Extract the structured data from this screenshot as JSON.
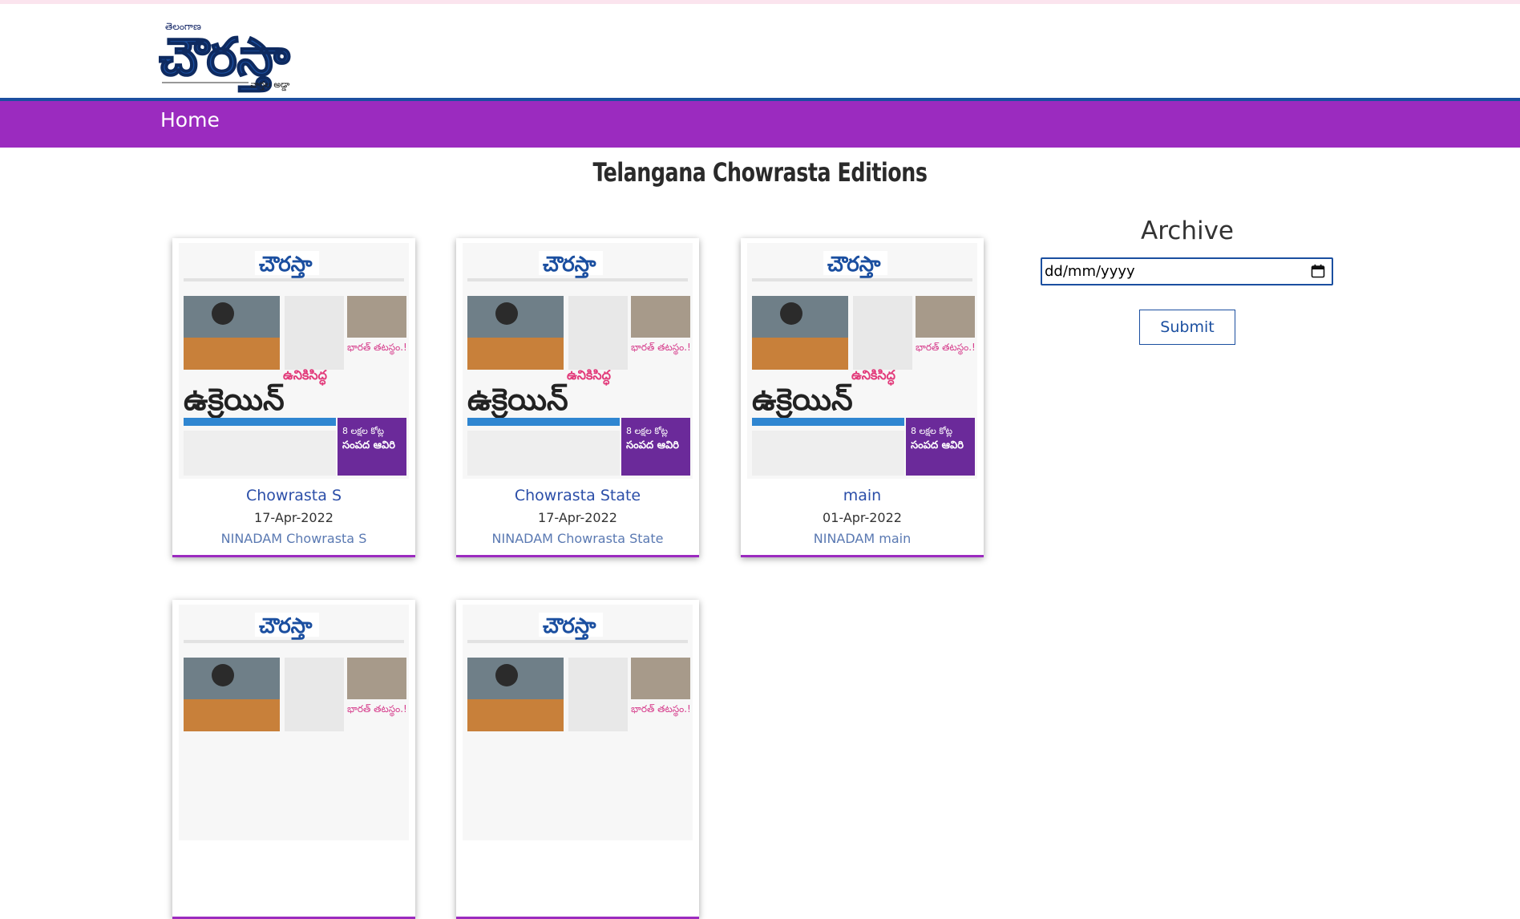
{
  "header": {
    "logo_small_text": "తెలంగాణ",
    "logo_main_text": "చౌరస్తా",
    "logo_tagline": "వార్తల అడ్డా"
  },
  "nav": {
    "home": "Home"
  },
  "page_title": "Telangana Chowrasta Editions",
  "thumbnail_text": {
    "masthead": "చౌరస్తా",
    "headline_small": "ఉనికిసిద్ధ",
    "headline_big": "ఉక్రెయిన్",
    "side_headline": "భారత్ తటస్థం.!",
    "purple_box_line1": "8 లక్షల కోట్ల",
    "purple_box_line2": "సంపద ఆవిరి"
  },
  "editions": [
    {
      "name": "Chowrasta S",
      "date": "17-Apr-2022",
      "subtitle": "NINADAM Chowrasta S"
    },
    {
      "name": "Chowrasta State",
      "date": "17-Apr-2022",
      "subtitle": "NINADAM Chowrasta State"
    },
    {
      "name": "main",
      "date": "01-Apr-2022",
      "subtitle": "NINADAM main"
    },
    {
      "name": "",
      "date": "",
      "subtitle": ""
    },
    {
      "name": "",
      "date": "",
      "subtitle": ""
    }
  ],
  "archive": {
    "title": "Archive",
    "date_placeholder": "dd/mm/yyyy",
    "submit_label": "Submit"
  },
  "colors": {
    "nav_bg": "#9b2bbf",
    "brand_blue": "#1b4fa0",
    "link_blue": "#2b4ea8"
  }
}
